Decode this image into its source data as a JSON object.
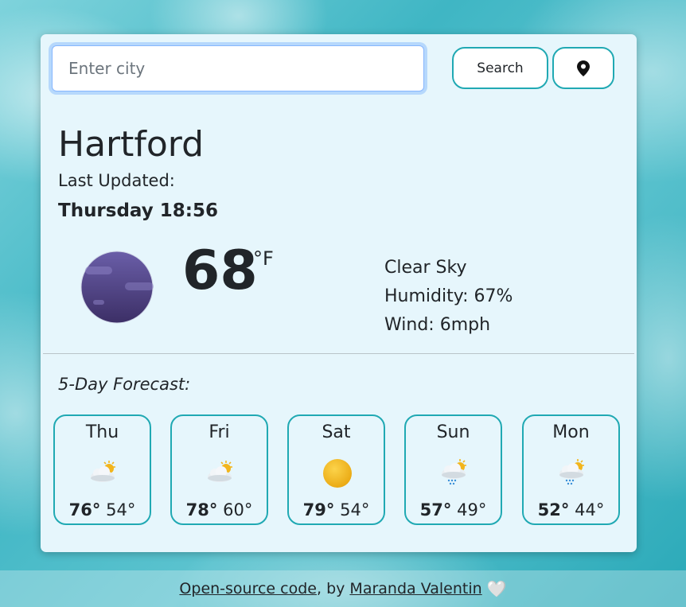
{
  "search": {
    "placeholder": "Enter city",
    "button_label": "Search",
    "location_icon": "map-pin-icon"
  },
  "current": {
    "city": "Hartford",
    "last_updated_label": "Last Updated:",
    "datetime": "Thursday 18:56",
    "icon": "clear-night-moon-icon",
    "temperature": "68",
    "unit": "°F",
    "description": "Clear Sky",
    "humidity": "Humidity: 67%",
    "wind": "Wind: 6mph"
  },
  "forecast": {
    "title": "5-Day Forecast:",
    "days": [
      {
        "day": "Thu",
        "icon": "partly-cloudy-icon",
        "high": "76°",
        "low": "54°"
      },
      {
        "day": "Fri",
        "icon": "partly-cloudy-icon",
        "high": "78°",
        "low": "60°"
      },
      {
        "day": "Sat",
        "icon": "sun-icon",
        "high": "79°",
        "low": "54°"
      },
      {
        "day": "Sun",
        "icon": "rain-cloud-sun-icon",
        "high": "57°",
        "low": "49°"
      },
      {
        "day": "Mon",
        "icon": "rain-cloud-sun-icon",
        "high": "52°",
        "low": "44°"
      }
    ]
  },
  "footer": {
    "code_link": "Open-source code",
    "by_text": ", by ",
    "author_link": "Maranda Valentin",
    "heart": "🤍"
  },
  "colors": {
    "accent_border": "#20a9b3",
    "card_background": "#e6f6fc",
    "moon": "#4b3f7e",
    "sun": "#f2b51c"
  }
}
